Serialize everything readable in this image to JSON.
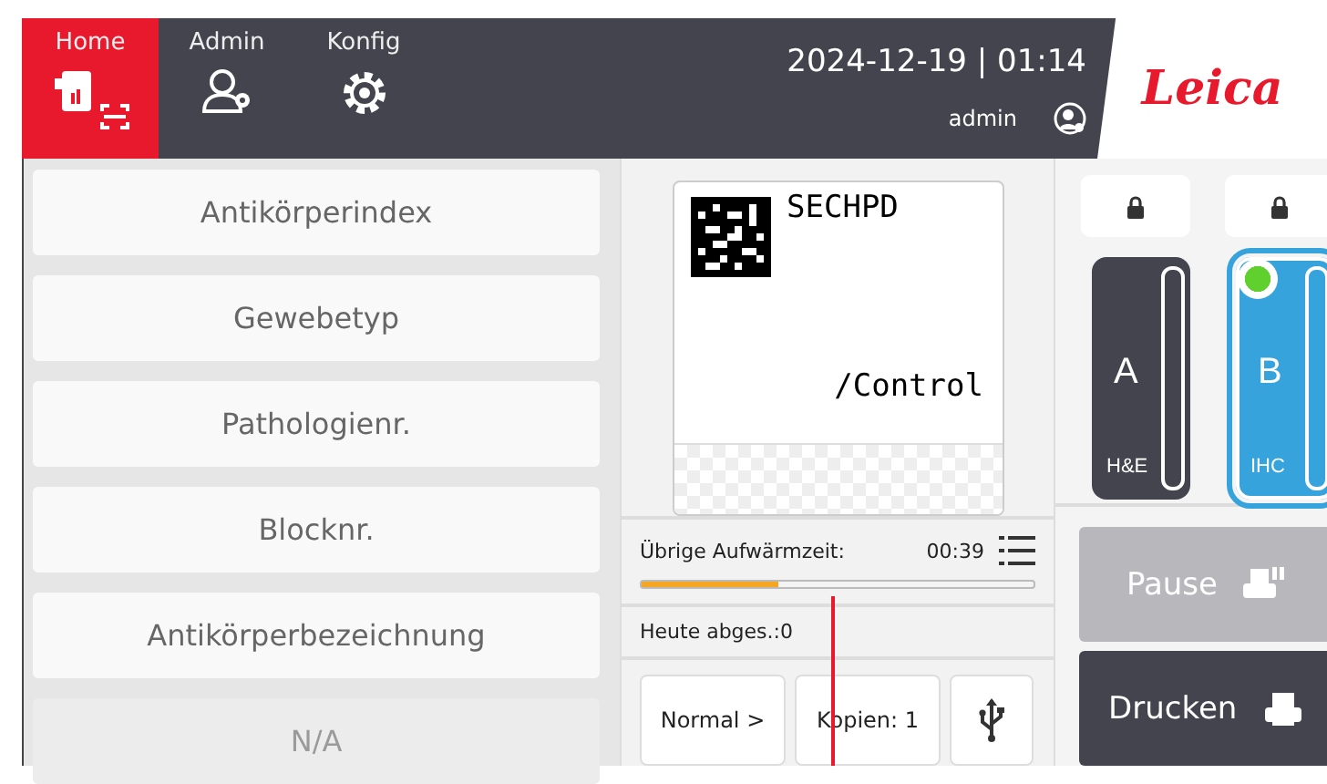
{
  "header": {
    "tabs": [
      {
        "label": "Home",
        "selected": true
      },
      {
        "label": "Admin",
        "selected": false
      },
      {
        "label": "Konfig",
        "selected": false
      }
    ],
    "datetime": "2024-12-19 | 01:14",
    "user": "admin",
    "logo": "Leica"
  },
  "fields": [
    {
      "label": "Antikörperindex",
      "disabled": false
    },
    {
      "label": "Gewebetyp",
      "disabled": false
    },
    {
      "label": "Pathologienr.",
      "disabled": false
    },
    {
      "label": "Blocknr.",
      "disabled": false
    },
    {
      "label": "Antikörperbezeichnung",
      "disabled": false
    },
    {
      "label": "N/A",
      "disabled": true
    }
  ],
  "label_preview": {
    "line_1": "SECHPD",
    "line_2": "/Control"
  },
  "warmup": {
    "label": "Übrige Aufwärmzeit:",
    "time": "00:39",
    "level": 0.35
  },
  "printed_today": "Heute abges.:0",
  "controls": {
    "mode": "Normal >",
    "copies": "Kopien: 1"
  },
  "magazines": [
    {
      "letter": "A",
      "type": "H&E",
      "selected": false,
      "locked": true,
      "active": false
    },
    {
      "letter": "B",
      "type": "IHC",
      "selected": true,
      "locked": true,
      "active": true
    }
  ],
  "actions": [
    {
      "kind": "pause",
      "label": "Pause",
      "disabled": true
    },
    {
      "kind": "print",
      "label": "Drucken",
      "disabled": false
    }
  ]
}
